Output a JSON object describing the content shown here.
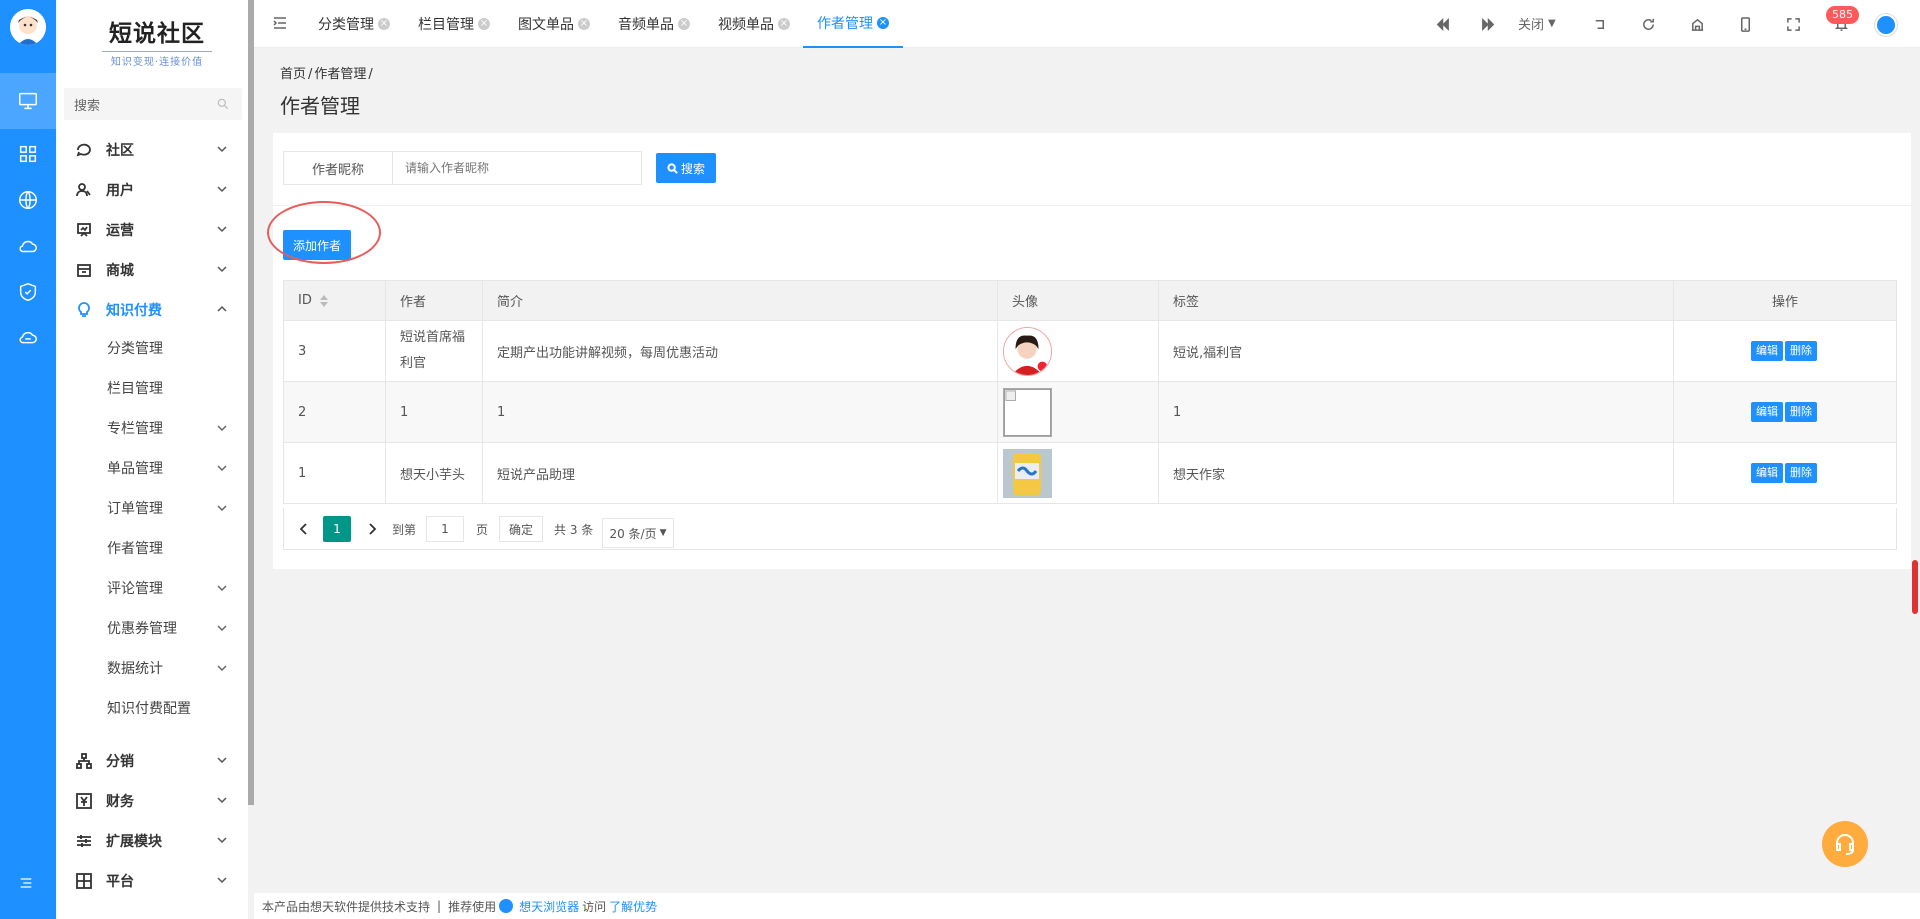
{
  "app": {
    "logo_title": "短说社区",
    "logo_subtitle": "知识变现·连接价值"
  },
  "sidebar": {
    "search_placeholder": "搜索",
    "groups": [
      {
        "label": "社区"
      },
      {
        "label": "用户"
      },
      {
        "label": "运营"
      },
      {
        "label": "商城"
      },
      {
        "label": "知识付费"
      }
    ],
    "sub_items": [
      {
        "label": "分类管理"
      },
      {
        "label": "栏目管理"
      },
      {
        "label": "专栏管理"
      },
      {
        "label": "单品管理"
      },
      {
        "label": "订单管理"
      },
      {
        "label": "作者管理"
      },
      {
        "label": "评论管理"
      },
      {
        "label": "优惠券管理"
      },
      {
        "label": "数据统计"
      },
      {
        "label": "知识付费配置"
      }
    ],
    "bottom_groups": [
      {
        "label": "分销"
      },
      {
        "label": "财务"
      },
      {
        "label": "扩展模块"
      },
      {
        "label": "平台"
      }
    ]
  },
  "tabs": [
    {
      "label": "分类管理"
    },
    {
      "label": "栏目管理"
    },
    {
      "label": "图文单品"
    },
    {
      "label": "音频单品"
    },
    {
      "label": "视频单品"
    },
    {
      "label": "作者管理"
    }
  ],
  "topbar": {
    "close_label": "关闭",
    "notification_count": "585"
  },
  "breadcrumb": {
    "home": "首页",
    "current": "作者管理",
    "sep": "/"
  },
  "page_title": "作者管理",
  "search": {
    "label": "作者昵称",
    "placeholder": "请输入作者昵称",
    "button": "搜索"
  },
  "add_button": "添加作者",
  "table": {
    "headers": {
      "id": "ID",
      "author": "作者",
      "intro": "简介",
      "avatar": "头像",
      "tags": "标签",
      "ops": "操作"
    },
    "rows": [
      {
        "id": "3",
        "author": "短说首席福利官",
        "intro": "定期产出功能讲解视频，每周优惠活动",
        "tags": "短说,福利官"
      },
      {
        "id": "2",
        "author": "1",
        "intro": "1",
        "tags": "1"
      },
      {
        "id": "1",
        "author": "想天小芋头",
        "intro": "短说产品助理",
        "tags": "想天作家"
      }
    ],
    "edit_label": "编辑",
    "delete_label": "删除"
  },
  "pagination": {
    "current_page": "1",
    "goto_label": "到第",
    "goto_value": "1",
    "page_unit": "页",
    "confirm": "确定",
    "total": "共 3 条",
    "page_size": "20 条/页"
  },
  "footer": {
    "text": "本产品由想天软件提供技术支持",
    "sep": "|",
    "recommend": "推荐使用",
    "browser": "想天浏览器",
    "visit": "访问",
    "learn": "了解优势"
  },
  "colors": {
    "primary": "#1e90ff",
    "pager_active": "#009688",
    "badge": "#ff5a5a",
    "annotation": "#e85c5c",
    "support": "#ffab3d"
  }
}
